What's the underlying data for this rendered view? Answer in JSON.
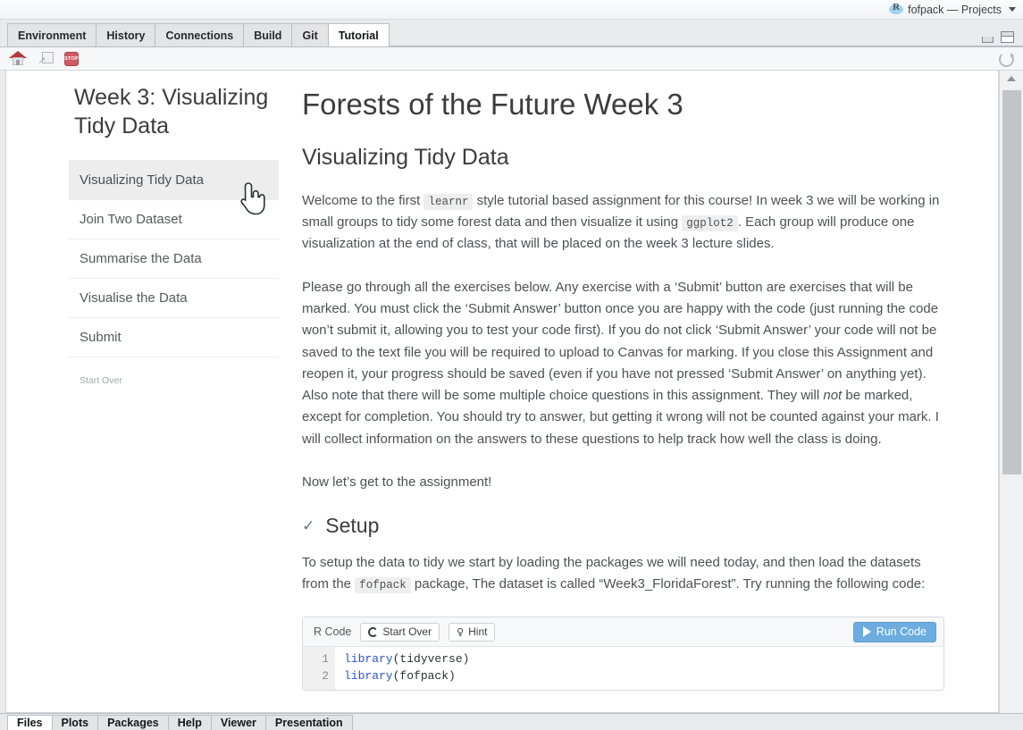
{
  "titlebar": {
    "project_label": "fofpack — Projects",
    "logo_letter": "R"
  },
  "tabs": [
    {
      "label": "Environment",
      "active": false
    },
    {
      "label": "History",
      "active": false
    },
    {
      "label": "Connections",
      "active": false
    },
    {
      "label": "Build",
      "active": false
    },
    {
      "label": "Git",
      "active": false
    },
    {
      "label": "Tutorial",
      "active": true
    }
  ],
  "toolbar": {
    "home_icon": "home-icon",
    "popout_icon": "popout-window-icon",
    "stop_icon": "stop-icon",
    "stop_label": "STOP",
    "refresh_icon": "refresh-icon"
  },
  "window_controls": {
    "minimize": "minimize-icon",
    "maximize": "maximize-icon"
  },
  "tutorial": {
    "sidebar_title": "Week 3: Visualizing Tidy Data",
    "nav": [
      {
        "label": "Visualizing Tidy Data",
        "active": true
      },
      {
        "label": "Join Two Dataset",
        "active": false
      },
      {
        "label": "Summarise the Data",
        "active": false
      },
      {
        "label": "Visualise the Data",
        "active": false
      },
      {
        "label": "Submit",
        "active": false
      }
    ],
    "start_over": "Start Over"
  },
  "doc": {
    "title": "Forests of the Future Week 3",
    "section_title": "Visualizing Tidy Data",
    "p1_a": "Welcome to the first",
    "p1_code1": "learnr",
    "p1_b": "style tutorial based assignment for this course! In week 3 we will be working in small groups to tidy some forest data and then visualize it using",
    "p1_code2": "ggplot2",
    "p1_c": ". Each group will produce one visualization at the end of class, that will be placed on the week 3 lecture slides.",
    "p2_a": "Please go through all the exercises below. Any exercise with a ‘Submit’ button are exercises that will be marked. You must click the ‘Submit Answer’ button once you are happy with the code (just running the code won’t submit it, allowing you to test your code first). If you do not click ‘Submit Answer’ your code will not be saved to the text file you will be required to upload to Canvas for marking. If you close this Assignment and reopen it, your progress should be saved (even if you have not pressed ‘Submit Answer’ on anything yet). Also note that there will be some multiple choice questions in this assignment. They will",
    "p2_italic": "not",
    "p2_b": "be marked, except for completion. You should try to answer, but getting it wrong will not be counted against your mark. I will collect information on the answers to these questions to help track how well the class is doing.",
    "p3": "Now let’s get to the assignment!",
    "setup_check": "✓",
    "setup_title": "Setup",
    "p4_a": "To setup the data to tidy we start by loading the packages we will need today, and then load the datasets from the",
    "p4_code": "fofpack",
    "p4_b": "package, The dataset is called “Week3_FloridaForest”. Try running the following code:"
  },
  "exercise": {
    "label": "R Code",
    "start_over_label": "Start Over",
    "hint_label": "Hint",
    "run_label": "Run Code",
    "run_color": "#6cacdf",
    "lines": [
      {
        "num": "1",
        "keyword": "library",
        "rest": "(tidyverse)"
      },
      {
        "num": "2",
        "keyword": "library",
        "rest": "(fofpack)"
      }
    ]
  },
  "bottom_tabs": [
    {
      "label": "Files",
      "active": true
    },
    {
      "label": "Plots",
      "active": false
    },
    {
      "label": "Packages",
      "active": false
    },
    {
      "label": "Help",
      "active": false
    },
    {
      "label": "Viewer",
      "active": false
    },
    {
      "label": "Presentation",
      "active": false
    }
  ]
}
